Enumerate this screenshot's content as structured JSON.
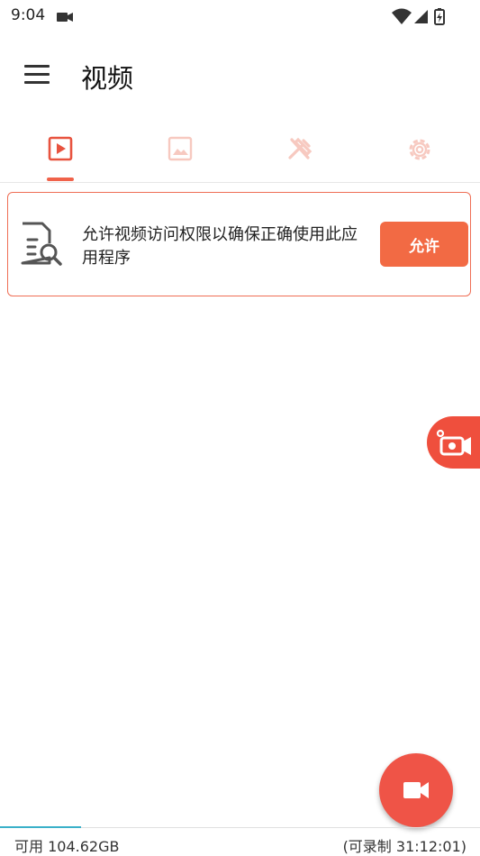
{
  "status_bar": {
    "time": "9:04",
    "icons": [
      "video-camera-icon",
      "wifi-icon",
      "signal-icon",
      "battery-charging-icon"
    ]
  },
  "app_bar": {
    "menu_icon": "hamburger-menu-icon",
    "title": "视频"
  },
  "tabs": [
    {
      "icon": "video-play-icon",
      "active": true
    },
    {
      "icon": "image-icon",
      "active": false
    },
    {
      "icon": "tools-icon",
      "active": false
    },
    {
      "icon": "settings-gear-icon",
      "active": false
    }
  ],
  "permission_card": {
    "icon": "document-search-icon",
    "message": "允许视频访问权限以确保正确使用此应用程序",
    "button_label": "允许"
  },
  "floating_record_widget": {
    "icon": "record-camera-icon"
  },
  "fab": {
    "icon": "video-camera-icon"
  },
  "footer": {
    "storage": "可用 104.62GB",
    "record_time": "(可录制 31:12:01)"
  },
  "colors": {
    "accent": "#ef5447",
    "button": "#f26a44",
    "inactive_tab": "#f7c9c0",
    "progress": "#3ab0c9"
  }
}
